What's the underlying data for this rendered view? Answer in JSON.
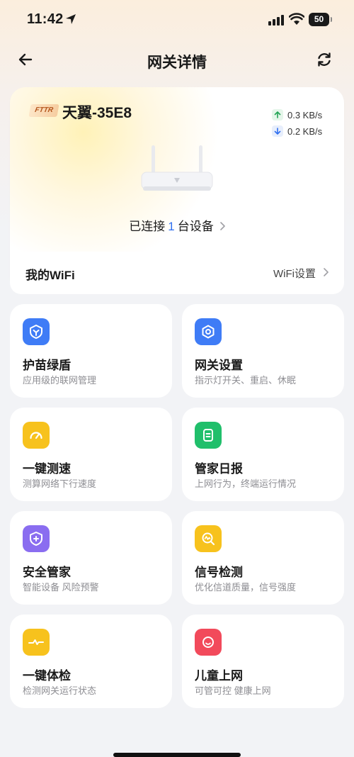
{
  "status_bar": {
    "time": "11:42",
    "battery": "50",
    "icons": [
      "location-arrow-icon",
      "cellular-signal-icon",
      "wifi-signal-icon",
      "battery-icon"
    ]
  },
  "nav": {
    "title": "网关详情",
    "back_icon": "back-arrow-icon",
    "refresh_icon": "refresh-icon"
  },
  "device": {
    "badge": "FTTR",
    "name": "天翼-35E8",
    "upload_speed": "0.3 KB/s",
    "download_speed": "0.2 KB/s",
    "connected_prefix": "已连接",
    "connected_count": "1",
    "connected_suffix": "台设备"
  },
  "wifi": {
    "title": "我的WiFi",
    "settings_label": "WiFi设置"
  },
  "tiles": [
    {
      "title": "护苗绿盾",
      "subtitle": "应用级的联网管理",
      "icon": "shield-leaf-icon",
      "color": "#3f7cf6"
    },
    {
      "title": "网关设置",
      "subtitle": "指示灯开关、重启、休眠",
      "icon": "hexagon-settings-icon",
      "color": "#3f7cf6"
    },
    {
      "title": "一键测速",
      "subtitle": "测算网络下行速度",
      "icon": "speedometer-icon",
      "color": "#f7c21d"
    },
    {
      "title": "管家日报",
      "subtitle": "上网行为，终端运行情况",
      "icon": "daily-report-icon",
      "color": "#20bf6b"
    },
    {
      "title": "安全管家",
      "subtitle": "智能设备 风险预警",
      "icon": "security-shield-plus-icon",
      "color": "#8a6df0"
    },
    {
      "title": "信号检测",
      "subtitle": "优化信道质量，信号强度",
      "icon": "signal-search-icon",
      "color": "#f7c21d"
    },
    {
      "title": "一键体检",
      "subtitle": "检测网关运行状态",
      "icon": "pulse-check-icon",
      "color": "#f7c21d"
    },
    {
      "title": "儿童上网",
      "subtitle": "可管可控 健康上网",
      "icon": "child-face-icon",
      "color": "#f24a5b"
    }
  ]
}
